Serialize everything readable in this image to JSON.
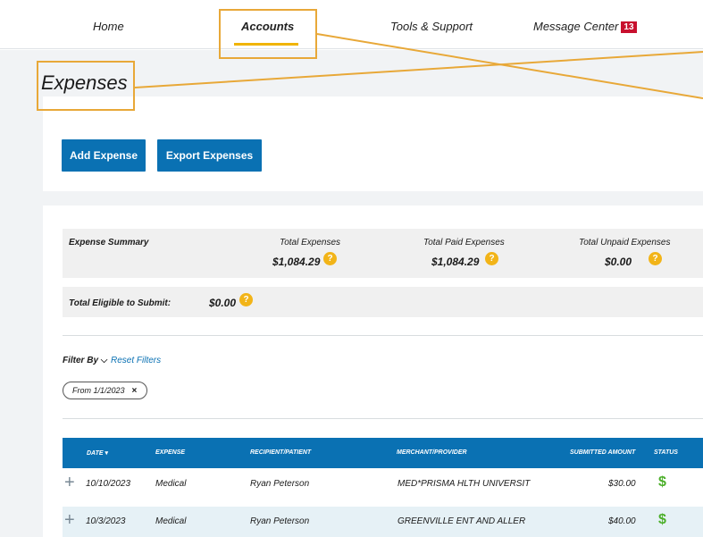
{
  "nav": {
    "home": "Home",
    "accounts": "Accounts",
    "tools": "Tools & Support",
    "messages": "Message Center",
    "message_count": "13"
  },
  "page": {
    "title": "Expenses"
  },
  "actions": {
    "add": "Add Expense",
    "export": "Export Expenses"
  },
  "summary": {
    "label": "Expense Summary",
    "total_label": "Total Expenses",
    "total_value": "$1,084.29",
    "paid_label": "Total Paid Expenses",
    "paid_value": "$1,084.29",
    "unpaid_label": "Total Unpaid Expenses",
    "unpaid_value": "$0.00",
    "help": "?"
  },
  "eligible": {
    "label": "Total Eligible to Submit:",
    "value": "$0.00"
  },
  "filters": {
    "filter_by": "Filter By",
    "reset": "Reset Filters",
    "chip": "From 1/1/2023",
    "chip_remove": "×"
  },
  "table": {
    "headers": [
      "DATE",
      "EXPENSE",
      "RECIPIENT/PATIENT",
      "MERCHANT/PROVIDER",
      "SUBMITTED AMOUNT",
      "STATUS"
    ],
    "rows": [
      {
        "date": "10/10/2023",
        "expense": "Medical",
        "recipient": "Ryan Peterson",
        "merchant": "MED*PRISMA HLTH UNIVERSIT",
        "amount": "$30.00",
        "status": "$"
      },
      {
        "date": "10/3/2023",
        "expense": "Medical",
        "recipient": "Ryan Peterson",
        "merchant": "GREENVILLE ENT AND ALLER",
        "amount": "$40.00",
        "status": "$"
      }
    ]
  },
  "colors": {
    "primary": "#0a71b3",
    "accent": "#f0b400",
    "badge": "#c8102e",
    "status_paid": "#4caf2a"
  },
  "icons": {
    "help": "help-circle-icon",
    "expand": "plus-icon",
    "sort": "caret-down-icon",
    "filter": "chevron-down-icon",
    "status": "dollar-icon"
  }
}
